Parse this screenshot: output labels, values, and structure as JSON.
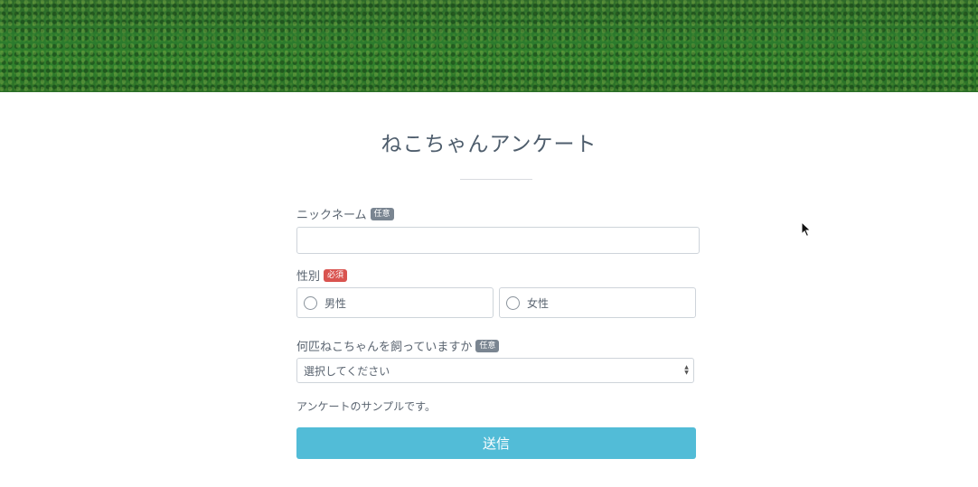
{
  "page": {
    "title": "ねこちゃんアンケート"
  },
  "form": {
    "nickname": {
      "label": "ニックネーム",
      "badge": "任意",
      "value": ""
    },
    "gender": {
      "label": "性別",
      "badge": "必須",
      "options": [
        "男性",
        "女性"
      ]
    },
    "cat_count": {
      "label": "何匹ねこちゃんを飼っていますか",
      "badge": "任意",
      "selected": "選択してください"
    },
    "note": "アンケートのサンプルです。",
    "submit_label": "送信"
  },
  "colors": {
    "accent": "#52bcd7",
    "required_badge": "#d9534f",
    "optional_badge": "#7a8591"
  },
  "icons": {
    "cursor": "mouse-pointer-icon",
    "select_arrows": "chevron-up-down-icon"
  }
}
